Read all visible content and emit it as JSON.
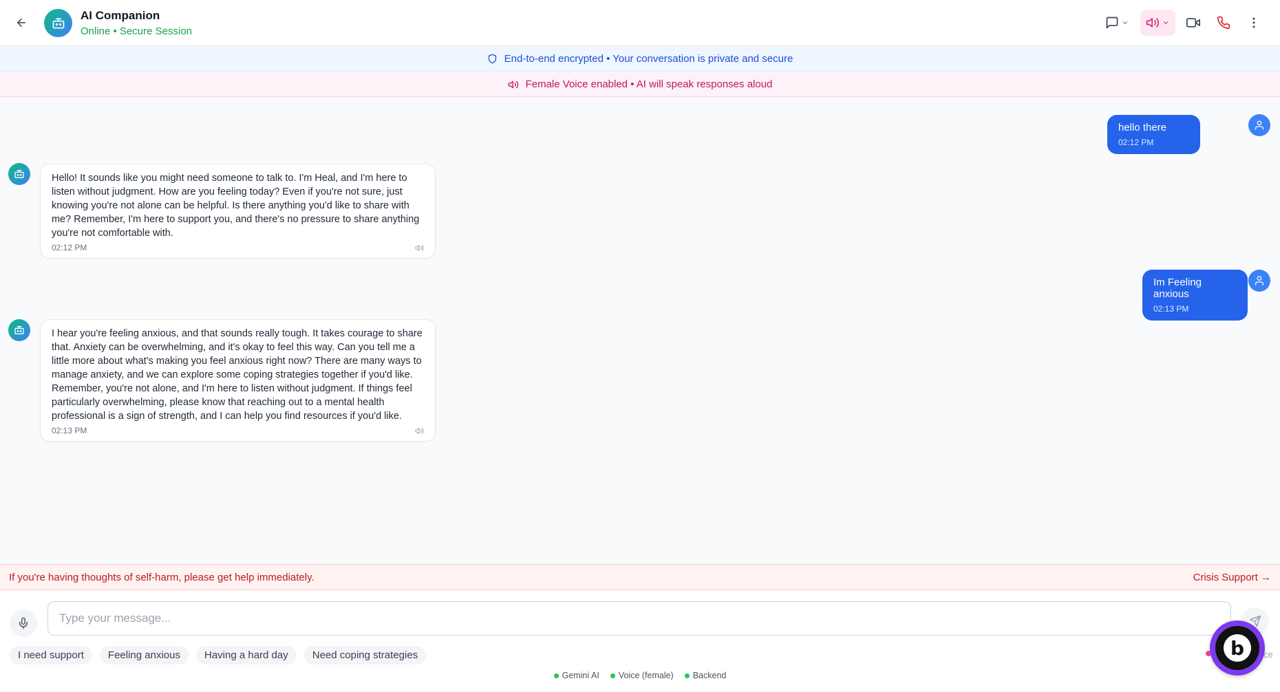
{
  "header": {
    "title": "AI Companion",
    "subtitle": "Online • Secure Session"
  },
  "banners": {
    "encryption": "End-to-end encrypted • Your conversation is private and secure",
    "voice": "Female Voice enabled • AI will speak responses aloud"
  },
  "messages": [
    {
      "role": "user",
      "text": "hello there",
      "time": "02:12 PM"
    },
    {
      "role": "assistant",
      "text": "Hello! It sounds like you might need someone to talk to. I'm Heal, and I'm here to listen without judgment. How are you feeling today? Even if you're not sure, just knowing you're not alone can be helpful. Is there anything you'd like to share with me? Remember, I'm here to support you, and there's no pressure to share anything you're not comfortable with.",
      "time": "02:12 PM"
    },
    {
      "role": "user",
      "text": "Im Feeling anxious",
      "time": "02:13 PM"
    },
    {
      "role": "assistant",
      "text": "I hear you're feeling anxious, and that sounds really tough. It takes courage to share that. Anxiety can be overwhelming, and it's okay to feel this way. Can you tell me a little more about what's making you feel anxious right now? There are many ways to manage anxiety, and we can explore some coping strategies together if you'd like. Remember, you're not alone, and I'm here to listen without judgment. If things feel particularly overwhelming, please know that reaching out to a mental health professional is a sign of strength, and I can help you find resources if you'd like.",
      "time": "02:13 PM"
    }
  ],
  "crisis": {
    "text": "If you're having thoughts of self-harm, please get help immediately.",
    "link": "Crisis Support →"
  },
  "input": {
    "placeholder": "Type your message...",
    "value": ""
  },
  "quick_replies": [
    "I need support",
    "Feeling anxious",
    "Having a hard day",
    "Need coping strategies"
  ],
  "status": [
    {
      "label": "Gemini AI",
      "color": "#22c55e"
    },
    {
      "label": "Voice (female)",
      "color": "#22c55e"
    },
    {
      "label": "Backend",
      "color": "#22c55e"
    }
  ],
  "bolt_badge": {
    "letter": "b"
  },
  "partial_text": "ce",
  "colors": {
    "primary": "#2563eb",
    "online": "#16a34a",
    "voice_accent": "#be185d",
    "crisis": "#b91c1c"
  }
}
